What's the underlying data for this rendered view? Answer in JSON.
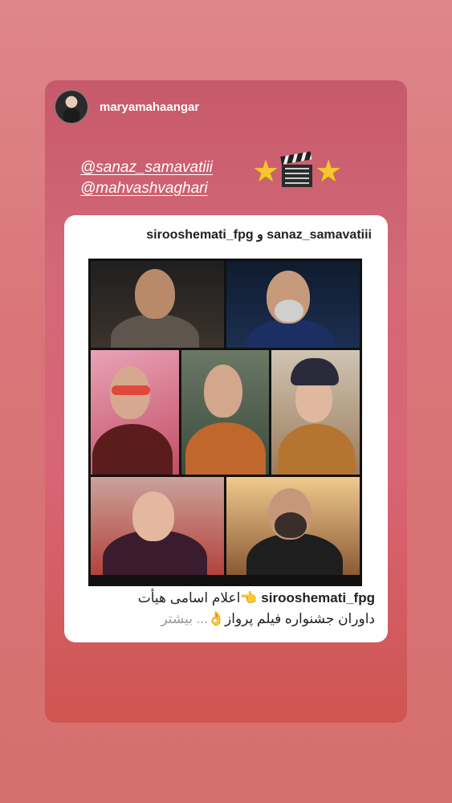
{
  "story": {
    "username": "maryamahaangar",
    "mentions": [
      "@sanaz_samavatiii",
      "@mahvashvaghari"
    ],
    "emoji_sequence": [
      "star-icon",
      "clapperboard-icon",
      "star-icon"
    ]
  },
  "post": {
    "header": "sirooshemati_fpg و sanaz_samavatiii",
    "caption_user": "sirooshemati_fpg",
    "caption_line1": "👈اعلام اسامی هیأت",
    "caption_line2": "داوران جشنواره فیلم پرواز👌",
    "more_label": "... بیشتر"
  },
  "colors": {
    "page_bg": "#de868a",
    "story_bg": "#d36878",
    "star": "#f7c62f"
  }
}
